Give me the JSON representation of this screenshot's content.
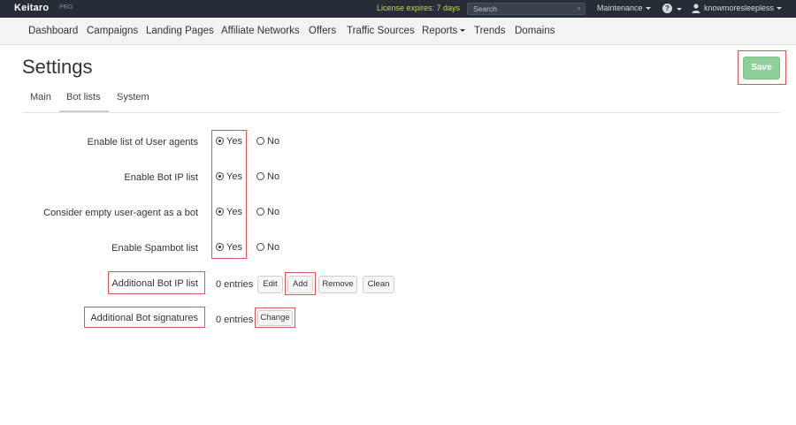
{
  "topbar": {
    "logo": "Keitaro",
    "logo_badge": "PRO",
    "license": "License expires: 7 days",
    "search_placeholder": "Search",
    "maintenance": "Maintenance",
    "help_symbol": "?",
    "username": "knowmoresleepless"
  },
  "nav": {
    "items": [
      "Dashboard",
      "Campaigns",
      "Landing Pages",
      "Affiliate Networks",
      "Offers",
      "Traffic Sources",
      "Reports",
      "Trends",
      "Domains"
    ]
  },
  "page": {
    "title": "Settings",
    "save_label": "Save"
  },
  "tabs": [
    "Main",
    "Bot lists",
    "System"
  ],
  "active_tab": "Bot lists",
  "settings": {
    "rows": [
      {
        "label": "Enable list of User agents",
        "yes": "Yes",
        "no": "No",
        "selected": "Yes"
      },
      {
        "label": "Enable Bot IP list",
        "yes": "Yes",
        "no": "No",
        "selected": "Yes"
      },
      {
        "label": "Consider empty user-agent as a bot",
        "yes": "Yes",
        "no": "No",
        "selected": "Yes"
      },
      {
        "label": "Enable Spambot list",
        "yes": "Yes",
        "no": "No",
        "selected": "Yes"
      }
    ],
    "bot_ip": {
      "label": "Additional Bot IP list",
      "entries": "0 entries",
      "buttons": [
        "Edit",
        "Add",
        "Remove",
        "Clean"
      ]
    },
    "bot_signatures": {
      "label": "Additional Bot signatures",
      "entries": "0 entries",
      "change_label": "Change"
    }
  },
  "colors": {
    "topbar_bg": "#262d35",
    "license_text": "#c9d34a",
    "save_bg": "#8fd09a",
    "highlight": "#e05555"
  }
}
